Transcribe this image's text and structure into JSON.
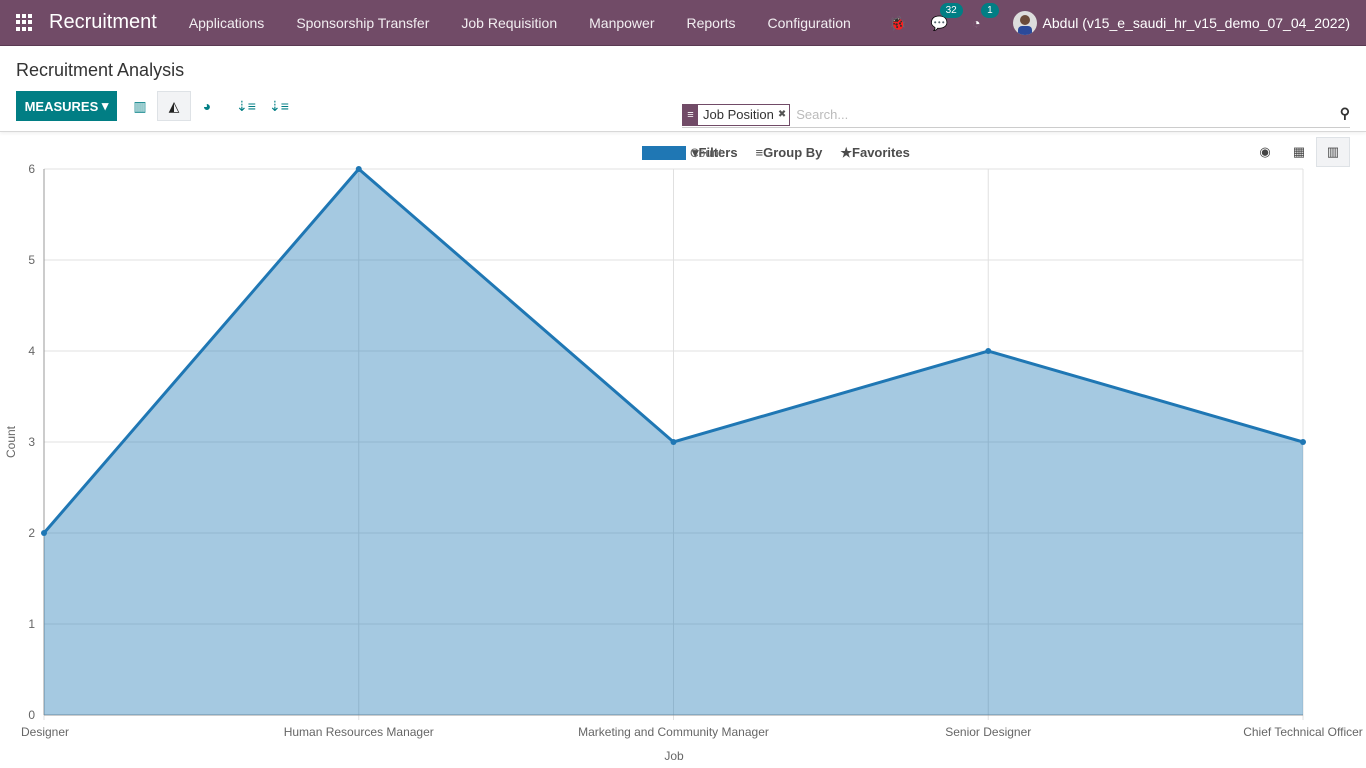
{
  "navbar": {
    "app_name": "Recruitment",
    "menu": [
      "Applications",
      "Sponsorship Transfer",
      "Job Requisition",
      "Manpower",
      "Reports",
      "Configuration"
    ],
    "messages_count": "32",
    "activities_count": "1",
    "user": "Abdul (v15_e_saudi_hr_v15_demo_07_04_2022)"
  },
  "control_panel": {
    "title": "Recruitment Analysis",
    "measures_label": "MEASURES",
    "search": {
      "facet": "Job Position",
      "placeholder": "Search..."
    },
    "filters_label": "Filters",
    "group_by_label": "Group By",
    "favorites_label": "Favorites"
  },
  "colors": {
    "navbar": "#714b67",
    "accent": "#017e84",
    "series": "#1f77b4"
  },
  "chart_data": {
    "type": "area",
    "categories": [
      "Designer",
      "Human Resources Manager",
      "Marketing and Community Manager",
      "Senior Designer",
      "Chief Technical Officer"
    ],
    "series": [
      {
        "name": "Count",
        "values": [
          2,
          6,
          3,
          4,
          3
        ]
      }
    ],
    "xlabel": "Job",
    "ylabel": "Count",
    "ylim": [
      0,
      6
    ],
    "yticks": [
      "0",
      "1",
      "2",
      "3",
      "4",
      "5",
      "6"
    ],
    "grid": true,
    "legend": "top"
  }
}
